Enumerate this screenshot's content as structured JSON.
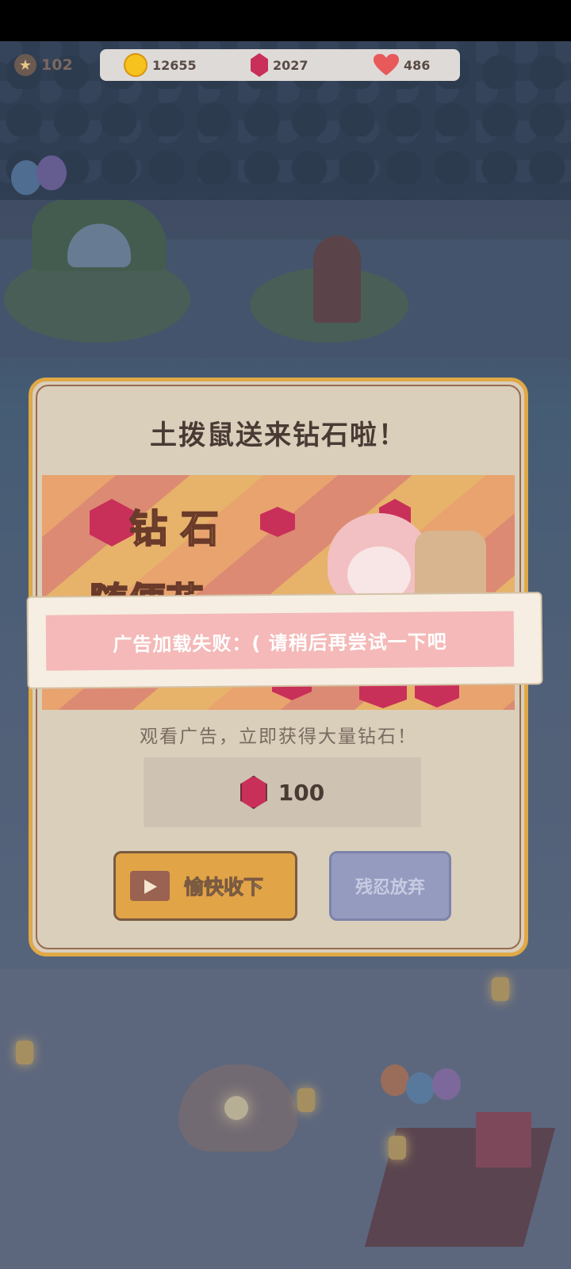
{
  "hud": {
    "level": "102",
    "coins": "12655",
    "gems": "2027",
    "hearts": "486",
    "icons": [
      "star-icon",
      "coin-icon",
      "gem-icon",
      "heart-icon"
    ]
  },
  "dialog": {
    "title": "土拨鼠送来钻石啦！",
    "banner_text_line1": "钻 石",
    "banner_text_line2": "随便花",
    "subtitle": "观看广告，立即获得大量钻石！",
    "reward_amount": "100",
    "accept_label": "愉快收下",
    "decline_label": "残忍放弃"
  },
  "toast": {
    "message": "广告加载失败：(  请稍后再尝试一下吧"
  },
  "colors": {
    "accent_gold": "#e1a447",
    "gem_red": "#c8305a",
    "toast_pink": "#f4b9b8",
    "decline_purple": "#959bbf"
  }
}
